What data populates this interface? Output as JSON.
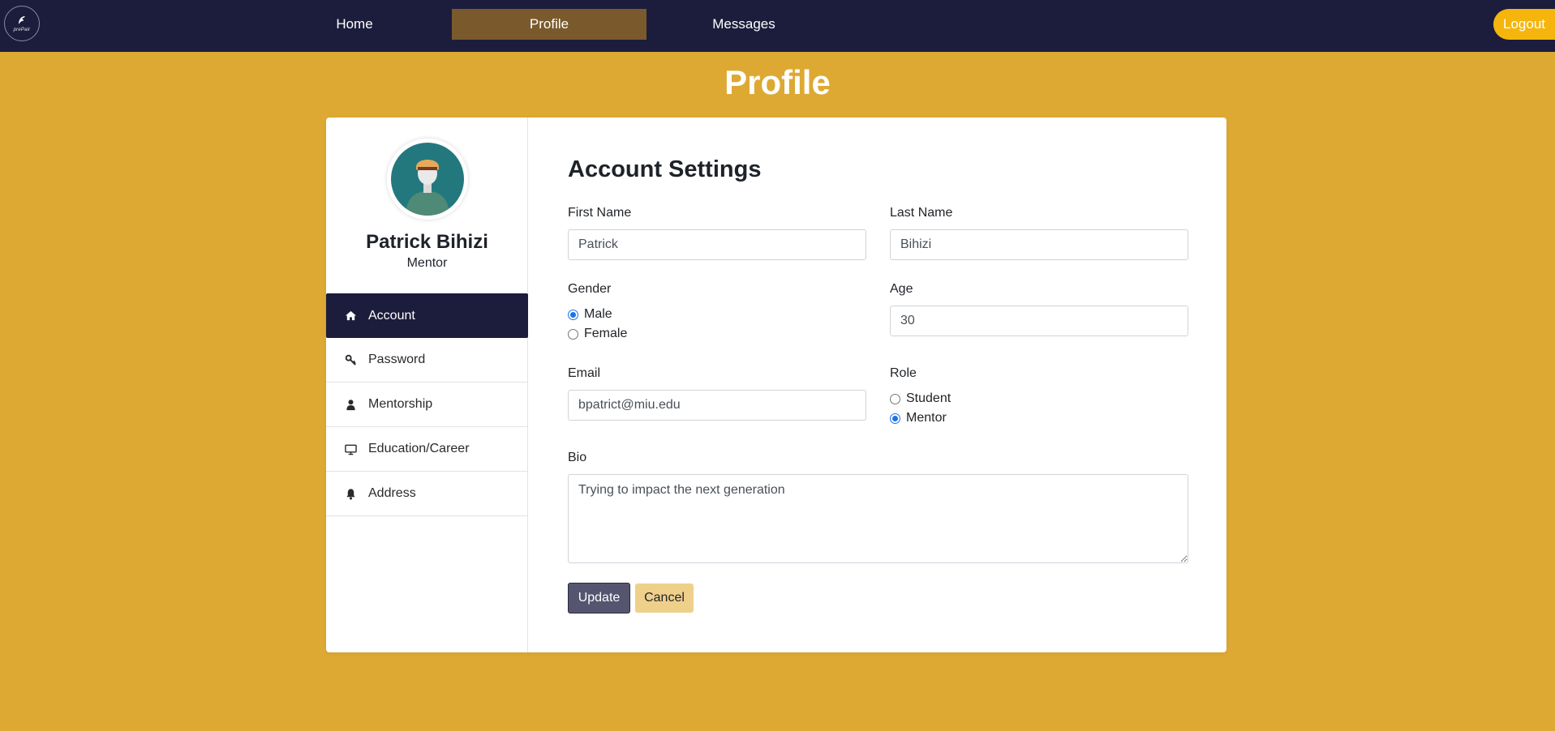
{
  "nav": {
    "logo_text": "prePair",
    "links": [
      {
        "label": "Home"
      },
      {
        "label": "Profile"
      },
      {
        "label": "Messages"
      }
    ],
    "logout_label": "Logout",
    "active_color": "#7A5A2C"
  },
  "page": {
    "title": "Profile",
    "background_color": "#DDA933",
    "navbar_color": "#1C1C3C"
  },
  "profile": {
    "name": "Patrick Bihizi",
    "role": "Mentor"
  },
  "sidebar": {
    "items": [
      {
        "label": "Account",
        "icon": "home-icon",
        "active": true
      },
      {
        "label": "Password",
        "icon": "key-icon",
        "active": false
      },
      {
        "label": "Mentorship",
        "icon": "user-icon",
        "active": false
      },
      {
        "label": "Education/Career",
        "icon": "monitor-icon",
        "active": false
      },
      {
        "label": "Address",
        "icon": "bell-icon",
        "active": false
      }
    ]
  },
  "form": {
    "title": "Account Settings",
    "first_name": {
      "label": "First Name",
      "value": "Patrick"
    },
    "last_name": {
      "label": "Last Name",
      "value": "Bihizi"
    },
    "gender": {
      "label": "Gender",
      "options": [
        "Male",
        "Female"
      ],
      "selected": "Male"
    },
    "age": {
      "label": "Age",
      "value": "30"
    },
    "email": {
      "label": "Email",
      "value": "bpatrict@miu.edu"
    },
    "role": {
      "label": "Role",
      "options": [
        "Student",
        "Mentor"
      ],
      "selected": "Mentor"
    },
    "bio": {
      "label": "Bio",
      "value": "Trying to impact the next generation"
    },
    "update_label": "Update",
    "cancel_label": "Cancel"
  }
}
